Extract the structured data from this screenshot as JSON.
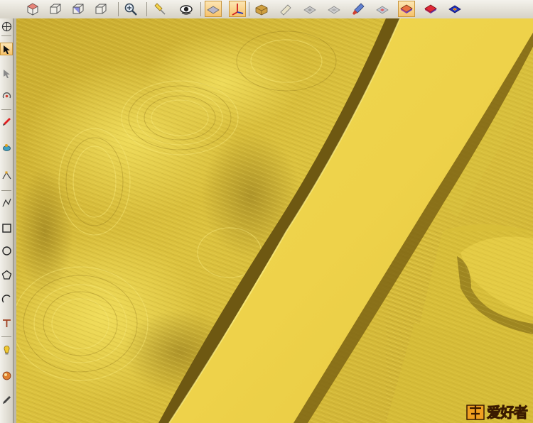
{
  "toolbar": {
    "buttons": [
      {
        "name": "view-iso-icon",
        "active": false
      },
      {
        "name": "view-front-icon",
        "active": false
      },
      {
        "name": "view-right-icon",
        "active": false
      },
      {
        "name": "view-top-icon",
        "active": false
      },
      {
        "name": "zoom-icon",
        "active": false
      },
      {
        "name": "light-icon",
        "active": false
      },
      {
        "name": "eye-icon",
        "active": false
      },
      {
        "name": "plane-icon",
        "active": true
      },
      {
        "name": "axis-icon",
        "active": true
      },
      {
        "name": "box-relief-icon",
        "active": false
      },
      {
        "name": "relief-tool-icon",
        "active": false
      },
      {
        "name": "relief-grey-icon",
        "active": false
      },
      {
        "name": "relief-plane-icon",
        "active": false
      },
      {
        "name": "brush-icon",
        "active": false
      },
      {
        "name": "color-relief-icon",
        "active": false
      },
      {
        "name": "shaded-relief-icon",
        "active": true
      },
      {
        "name": "red-relief-icon",
        "active": false
      },
      {
        "name": "red-blue-relief-icon",
        "active": false
      }
    ]
  },
  "left_tools": [
    {
      "name": "globe-icon",
      "active": false
    },
    {
      "name": "select-arrow-icon",
      "active": true
    },
    {
      "name": "move-arrow-icon",
      "active": false
    },
    {
      "name": "rotate-node-icon",
      "active": false
    },
    {
      "name": "red-pen-icon",
      "active": false
    },
    {
      "name": "paint-icon",
      "active": false
    },
    {
      "name": "node-edit-icon",
      "active": false
    },
    {
      "name": "polyline-icon",
      "active": false
    },
    {
      "name": "rectangle-icon",
      "active": false
    },
    {
      "name": "circle-icon",
      "active": false
    },
    {
      "name": "polygon-icon",
      "active": false
    },
    {
      "name": "arc-icon",
      "active": false
    },
    {
      "name": "text-icon",
      "active": false
    },
    {
      "name": "bulb-icon",
      "active": false
    },
    {
      "name": "color-icon",
      "active": false
    },
    {
      "name": "pencil-icon",
      "active": false
    }
  ],
  "colors": {
    "relief_base": "#d9be3a",
    "relief_light": "#f2de55",
    "relief_shadow": "#8a7018",
    "ribbon": "#edd24a",
    "ribbon_shadow": "#6e5812"
  },
  "watermark": {
    "text": "爱好者"
  }
}
